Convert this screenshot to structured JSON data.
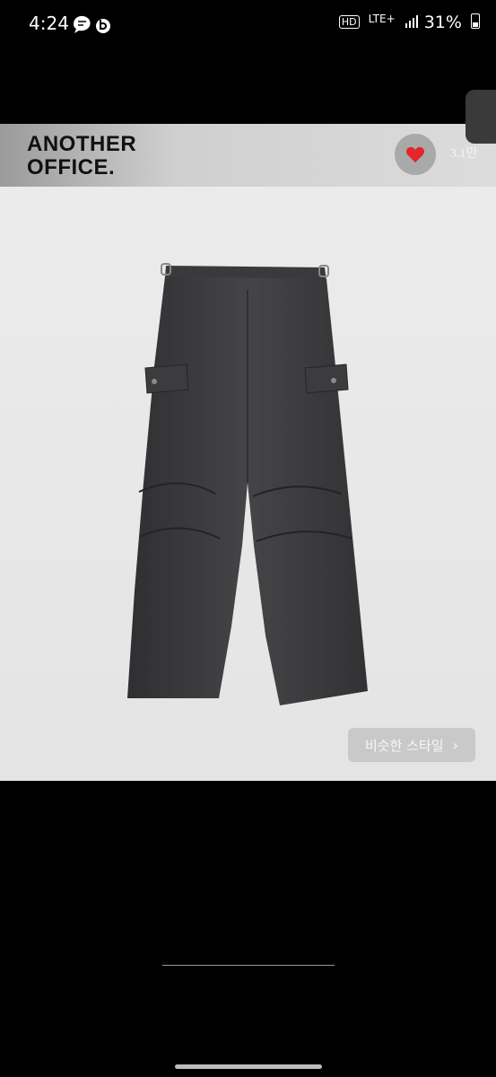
{
  "status_bar": {
    "time": "4:24",
    "left_icons": [
      "chat-icon",
      "b-app-icon"
    ],
    "hd": "HD",
    "network": "LTE+",
    "battery": "31%"
  },
  "product": {
    "brand_line1": "ANOTHER",
    "brand_line2": "OFFICE.",
    "like_count": "3.1만",
    "similar_style_label": "비슷한 스타일",
    "similar_style_chevron": "›",
    "accent_colors": {
      "heart": "#e3262c",
      "pants": "#3f3f41"
    }
  }
}
